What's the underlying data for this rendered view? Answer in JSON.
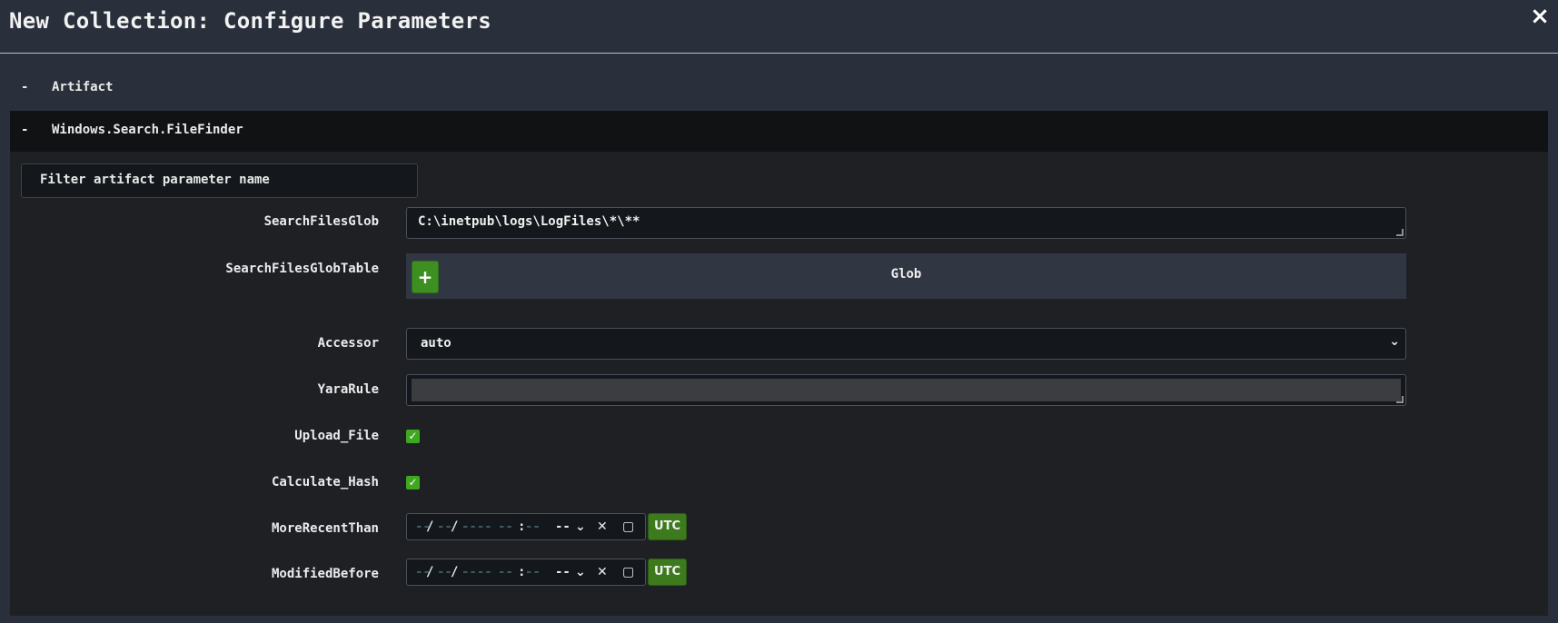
{
  "header": {
    "title": "New Collection: Configure Parameters",
    "close_symbol": "×"
  },
  "sections": {
    "artifact": {
      "toggle": "-",
      "label": "Artifact"
    },
    "finder": {
      "toggle": "-",
      "label": "Windows.Search.FileFinder"
    }
  },
  "filter": {
    "placeholder": "Filter artifact parameter name"
  },
  "params": {
    "search_files_glob": {
      "label": "SearchFilesGlob",
      "value": "C:\\inetpub\\logs\\LogFiles\\*\\**"
    },
    "search_files_glob_table": {
      "label": "SearchFilesGlobTable",
      "add_symbol": "+",
      "column": "Glob"
    },
    "accessor": {
      "label": "Accessor",
      "value": "auto",
      "chevron": "⌄"
    },
    "yara_rule": {
      "label": "YaraRule",
      "value": ""
    },
    "upload_file": {
      "label": "Upload_File",
      "checked": true,
      "check_symbol": "✓"
    },
    "calculate_hash": {
      "label": "Calculate_Hash",
      "checked": true,
      "check_symbol": "✓"
    },
    "more_recent_than": {
      "label": "MoreRecentThan",
      "date_mm": "--",
      "sep1": "/",
      "date_dd": "--",
      "sep2": "/",
      "date_yyyy": "----",
      "time_hh": "--",
      "colon": ":",
      "time_mm": "--",
      "ampm": "--",
      "chevron": "⌄",
      "clear": "✕",
      "calendar": "▢",
      "utc": "UTC"
    },
    "modified_before": {
      "label": "ModifiedBefore",
      "date_mm": "--",
      "sep1": "/",
      "date_dd": "--",
      "sep2": "/",
      "date_yyyy": "----",
      "time_hh": "--",
      "colon": ":",
      "time_mm": "--",
      "ampm": "--",
      "chevron": "⌄",
      "clear": "✕",
      "calendar": "▢",
      "utc": "UTC"
    }
  }
}
